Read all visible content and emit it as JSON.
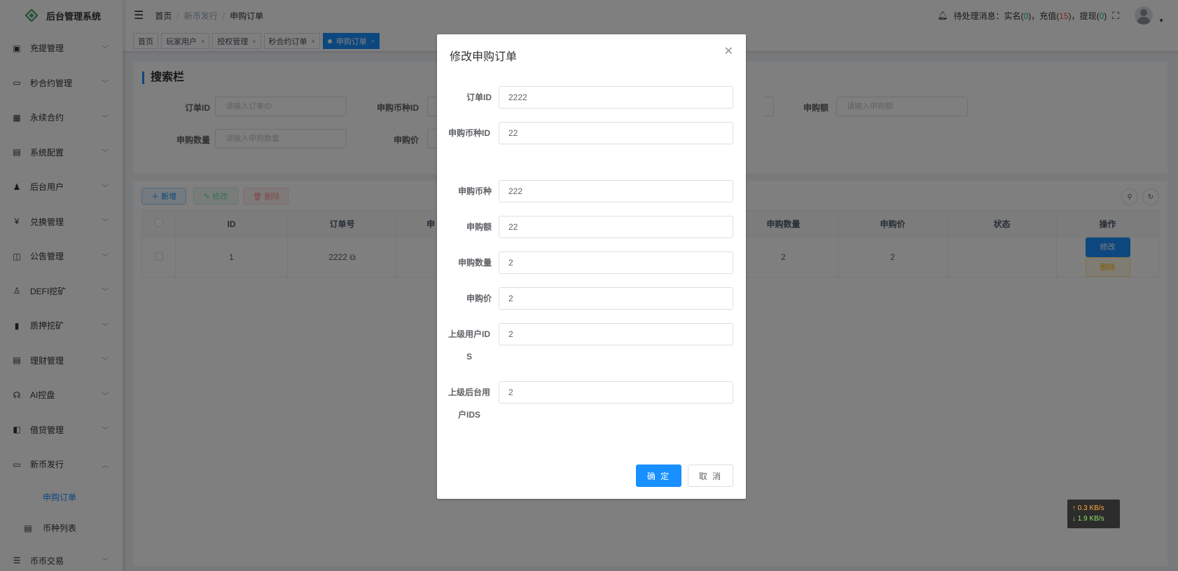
{
  "app": {
    "title": "后台管理系统",
    "brand_color": "#4aa36c"
  },
  "sidebar": {
    "items": [
      {
        "label": "充提管理",
        "icon": "copy-icon",
        "glyph": "▣"
      },
      {
        "label": "秒合约管理",
        "icon": "monitor-icon",
        "glyph": "▭"
      },
      {
        "label": "永续合约",
        "icon": "grid-icon",
        "glyph": "▦"
      },
      {
        "label": "系统配置",
        "icon": "document-icon",
        "glyph": "▤"
      },
      {
        "label": "后台用户",
        "icon": "user-group-icon",
        "glyph": "♟"
      },
      {
        "label": "兑换管理",
        "icon": "yen-icon",
        "glyph": "¥"
      },
      {
        "label": "公告管理",
        "icon": "book-icon",
        "glyph": "◫"
      },
      {
        "label": "DEFI挖矿",
        "icon": "pickaxe-icon",
        "glyph": "♙"
      },
      {
        "label": "质押挖矿",
        "icon": "bar-chart-icon",
        "glyph": "▮"
      },
      {
        "label": "理财管理",
        "icon": "ledger-icon",
        "glyph": "▤"
      },
      {
        "label": "AI控盘",
        "icon": "robot-icon",
        "glyph": "☊"
      },
      {
        "label": "借贷管理",
        "icon": "loan-icon",
        "glyph": "◧"
      },
      {
        "label": "新币发行",
        "icon": "coin-issue-icon",
        "glyph": "▭"
      }
    ],
    "submenu": [
      {
        "label": "申购订单",
        "active": true
      },
      {
        "label": "币种列表",
        "active": false
      }
    ],
    "last_item": {
      "label": "币币交易",
      "icon": "list-icon",
      "glyph": "☰"
    }
  },
  "navbar": {
    "breadcrumb": [
      "首页",
      "新币发行",
      "申购订单"
    ],
    "notice_label": "待处理消息：实名(",
    "notice_real": "0",
    "notice_mid1": ")，充值(",
    "notice_deposit": "15",
    "notice_mid2": ")，提现(",
    "notice_withdraw": "0",
    "notice_end": ")"
  },
  "tags": [
    {
      "label": "首页",
      "active": false,
      "closable": false
    },
    {
      "label": "玩家用户",
      "active": false,
      "closable": true
    },
    {
      "label": "授权管理",
      "active": false,
      "closable": true
    },
    {
      "label": "秒合约订单",
      "active": false,
      "closable": true
    },
    {
      "label": "申购订单",
      "active": true,
      "closable": true
    }
  ],
  "search": {
    "title": "搜索栏",
    "fields": [
      {
        "label": "订单ID",
        "placeholder": "请输入订单ID"
      },
      {
        "label": "申购币种ID",
        "placeholder": ""
      },
      {
        "label": "申购额",
        "placeholder": "请输入申购额"
      },
      {
        "label": "申购数量",
        "placeholder": "请输入申购数量"
      },
      {
        "label": "申购价",
        "placeholder": ""
      }
    ]
  },
  "toolbar": {
    "add": "新增",
    "edit": "修改",
    "delete": "删除"
  },
  "table": {
    "headers": [
      "ID",
      "订单号",
      "申",
      "申购数量",
      "申购价",
      "状态",
      "操作"
    ],
    "rows": [
      {
        "id": "1",
        "order_no": "2222",
        "col3": "",
        "qty": "2",
        "price": "2",
        "status": "",
        "edit": "修改",
        "delete": "删除"
      }
    ]
  },
  "speed": {
    "up": "0.3 KB/s",
    "down": "1.9 KB/s"
  },
  "dialog": {
    "title": "修改申购订单",
    "fields": [
      {
        "label": "订单ID",
        "value": "2222"
      },
      {
        "label": "申购币种ID",
        "value": "22"
      },
      {
        "label": "申购币种",
        "value": "222"
      },
      {
        "label": "申购额",
        "value": "22"
      },
      {
        "label": "申购数量",
        "value": "2"
      },
      {
        "label": "申购价",
        "value": "2"
      },
      {
        "label": "上级用户IDS",
        "value": "2"
      },
      {
        "label": "上级后台用户IDS",
        "value": "2"
      }
    ],
    "ok": "确 定",
    "cancel": "取 消"
  }
}
